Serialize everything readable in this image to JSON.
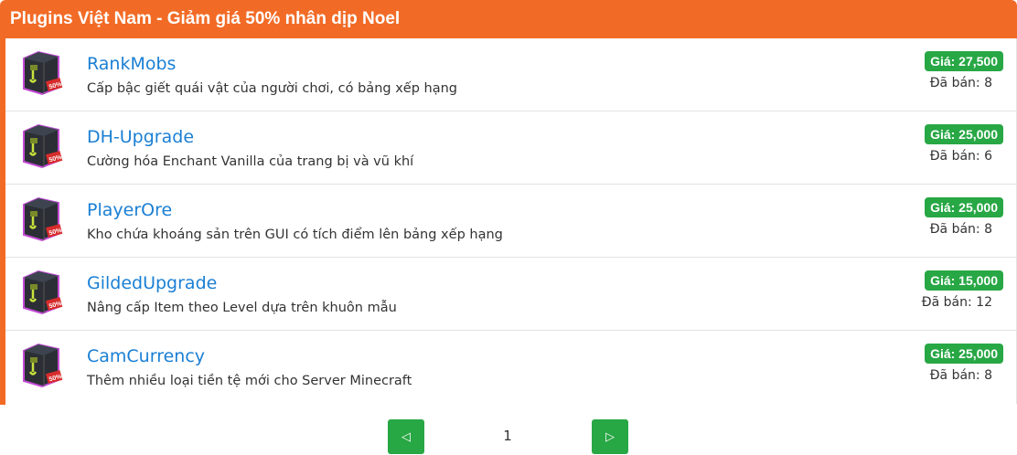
{
  "header": {
    "title": "Plugins Việt Nam - Giảm giá 50% nhân dịp Noel"
  },
  "items": [
    {
      "name": "RankMobs",
      "desc": "Cấp bậc giết quái vật của người chơi, có bảng xếp hạng",
      "price": "Giá: 27,500",
      "sold": "Đã bán: 8"
    },
    {
      "name": "DH-Upgrade",
      "desc": "Cường hóa Enchant Vanilla của trang bị và vũ khí",
      "price": "Giá: 25,000",
      "sold": "Đã bán: 6"
    },
    {
      "name": "PlayerOre",
      "desc": "Kho chứa khoáng sản trên GUI có tích điểm lên bảng xếp hạng",
      "price": "Giá: 25,000",
      "sold": "Đã bán: 8"
    },
    {
      "name": "GildedUpgrade",
      "desc": "Nâng cấp Item theo Level dựa trên khuôn mẫu",
      "price": "Giá: 15,000",
      "sold": "Đã bán: 12"
    },
    {
      "name": "CamCurrency",
      "desc": "Thêm nhiều loại tiền tệ mới cho Server Minecraft",
      "price": "Giá: 25,000",
      "sold": "Đã bán: 8"
    }
  ],
  "thumb_badge": "50%",
  "pagination": {
    "prev_icon": "◁",
    "current_page": "1",
    "next_icon": "▷"
  },
  "colors": {
    "accent": "#f26b26",
    "price_badge": "#28a745",
    "link": "#1a7fd4"
  }
}
